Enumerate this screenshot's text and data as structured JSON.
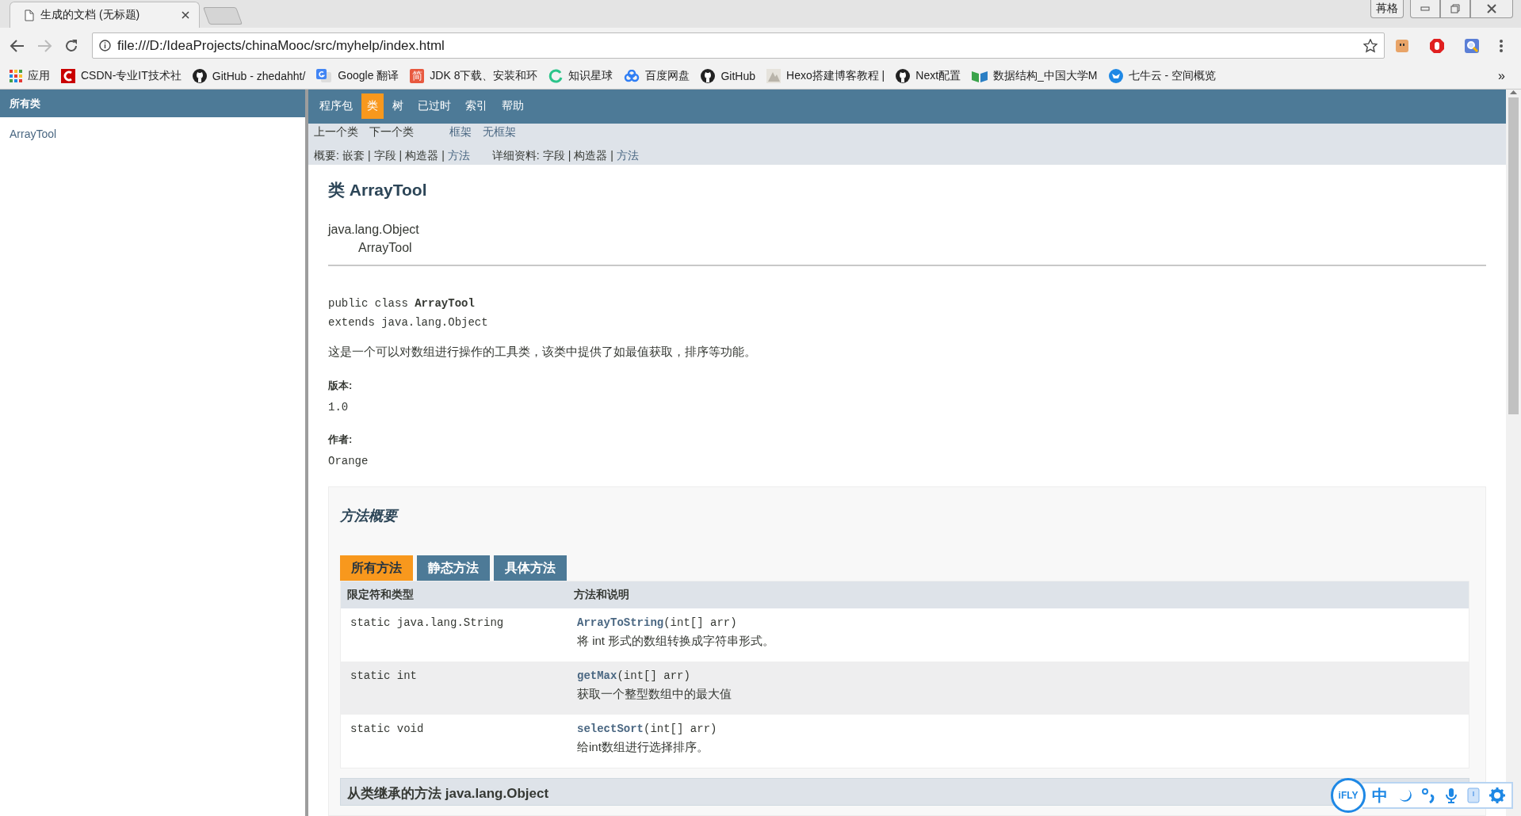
{
  "browser": {
    "tab": {
      "title": "生成的文档 (无标题)"
    },
    "window_button": "苒格",
    "url": "file:///D:/IdeaProjects/chinaMooc/src/myhelp/index.html",
    "bookmarks": [
      {
        "kind": "apps",
        "label": "应用"
      },
      {
        "kind": "csdn",
        "label": "CSDN-专业IT技术社"
      },
      {
        "kind": "github",
        "label": "GitHub - zhedahht/"
      },
      {
        "kind": "translate",
        "label": "Google 翻译"
      },
      {
        "kind": "badge",
        "badge": "简",
        "label": "JDK 8下载、安装和环"
      },
      {
        "kind": "ring",
        "label": "知识星球"
      },
      {
        "kind": "cloud",
        "label": "百度网盘"
      },
      {
        "kind": "github",
        "label": "GitHub"
      },
      {
        "kind": "thumb",
        "label": "Hexo搭建博客教程 |"
      },
      {
        "kind": "github",
        "label": "Next配置"
      },
      {
        "kind": "book",
        "label": "数据结构_中国大学M"
      },
      {
        "kind": "bull",
        "label": "七牛云 - 空间概览"
      }
    ],
    "overflow": "»"
  },
  "sidebar": {
    "title": "所有类",
    "items": [
      "ArrayTool"
    ]
  },
  "nav": {
    "items": [
      {
        "label": "程序包",
        "selected": false
      },
      {
        "label": "类",
        "selected": true
      },
      {
        "label": "树",
        "selected": false
      },
      {
        "label": "已过时",
        "selected": false
      },
      {
        "label": "索引",
        "selected": false
      },
      {
        "label": "帮助",
        "selected": false
      }
    ]
  },
  "subnav": {
    "items": [
      {
        "label": "上一个类",
        "kind": "text"
      },
      {
        "label": "下一个类",
        "kind": "text"
      },
      {
        "label": "框架",
        "kind": "link"
      },
      {
        "label": "无框架",
        "kind": "link"
      }
    ],
    "summary": {
      "label": "概要:",
      "separator": "|",
      "items": [
        {
          "label": "嵌套",
          "kind": "text"
        },
        {
          "label": "字段",
          "kind": "text"
        },
        {
          "label": "构造器",
          "kind": "text"
        },
        {
          "label": "方法",
          "kind": "link"
        }
      ]
    },
    "detail": {
      "label": "详细资料:",
      "separator": "|",
      "items": [
        {
          "label": "字段",
          "kind": "text"
        },
        {
          "label": "构造器",
          "kind": "text"
        },
        {
          "label": "方法",
          "kind": "link"
        }
      ]
    }
  },
  "class_title": "类 ArrayTool",
  "inheritance": [
    "java.lang.Object",
    "ArrayTool"
  ],
  "signature": [
    "public class **ArrayTool**",
    "extends java.lang.Object"
  ],
  "description": "这是一个可以对数组进行操作的工具类，该类中提供了如最值获取，排序等功能。",
  "tags": [
    {
      "label": "版本:",
      "value": "1.0"
    },
    {
      "label": "作者:",
      "value": "Orange"
    }
  ],
  "method_summary": {
    "title": "方法概要",
    "tabs": [
      {
        "label": "所有方法",
        "selected": true
      },
      {
        "label": "静态方法",
        "selected": false
      },
      {
        "label": "具体方法",
        "selected": false
      }
    ],
    "columns": [
      "限定符和类型",
      "方法和说明"
    ],
    "rows": [
      {
        "type": "static java.lang.String",
        "name": "ArrayToString",
        "params": "(int[]  arr)",
        "description": "将 int 形式的数组转换成字符串形式。"
      },
      {
        "type": "static int",
        "name": "getMax",
        "params": "(int[]  arr)",
        "description": "获取一个整型数组中的最大值"
      },
      {
        "type": "static void",
        "name": "selectSort",
        "params": "(int[]  arr)",
        "description": "给int数组进行选择排序。"
      }
    ]
  },
  "inherited_title": "从类继承的方法 java.lang.Object",
  "ifly": {
    "logo": "iFLY",
    "mode": "中"
  }
}
